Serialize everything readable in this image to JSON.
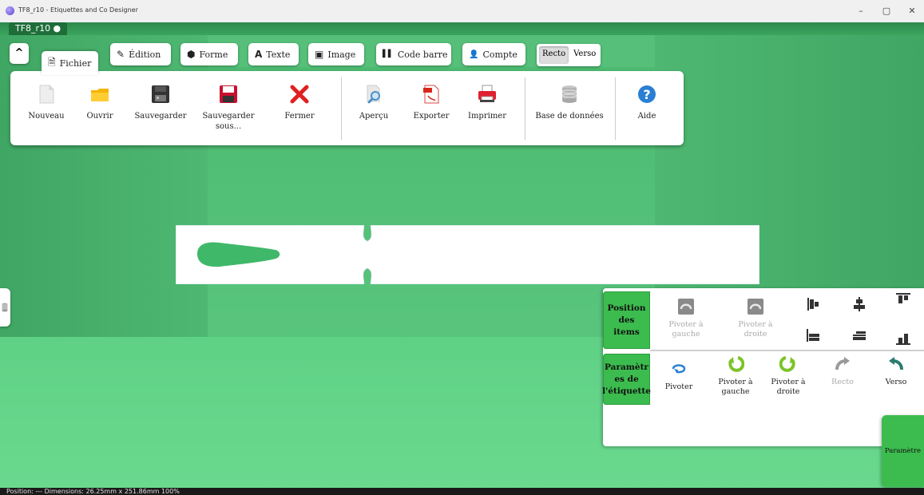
{
  "window": {
    "title": "TF8_r10 - Etiquettes and Co Designer",
    "minimize": "–",
    "maximize": "▢",
    "close": "✕"
  },
  "doc_tab": {
    "label": "TF8_r10 ●"
  },
  "ribbon": {
    "collapse": "^",
    "tabs": [
      {
        "label": "Fichier",
        "icon": "file-icon",
        "glyph": "🗎"
      },
      {
        "label": "Édition",
        "icon": "pencil-icon",
        "glyph": "✎"
      },
      {
        "label": "Forme",
        "icon": "shapes-icon",
        "glyph": "⬢"
      },
      {
        "label": "Texte",
        "icon": "text-icon",
        "glyph": "A"
      },
      {
        "label": "Image",
        "icon": "image-icon",
        "glyph": "▣"
      },
      {
        "label": "Code barre",
        "icon": "barcode-icon",
        "glyph": "▌▌"
      },
      {
        "label": "Compte",
        "icon": "user-icon",
        "glyph": "👤"
      }
    ],
    "recto": "Recto",
    "verso": "Verso",
    "fichier_items": {
      "nouveau": "Nouveau",
      "ouvrir": "Ouvrir",
      "sauvegarder": "Sauvegarder",
      "sauvegarder_sous_1": "Sauvegarder",
      "sauvegarder_sous_2": "sous...",
      "fermer": "Fermer",
      "apercu": "Aperçu",
      "exporter": "Exporter",
      "imprimer": "Imprimer",
      "base": "Base de données",
      "aide": "Aide"
    }
  },
  "position_panel": {
    "section_positions_1": "Position",
    "section_positions_2": "des",
    "section_positions_3": "items",
    "pivoter_gauche_1": "Pivoter à",
    "pivoter_gauche_2": "gauche",
    "pivoter_droite_1": "Pivoter à",
    "pivoter_droite_2": "droite",
    "section_params_1": "Paramètr",
    "section_params_2": "es de",
    "section_params_3": "l'étiquette",
    "pivoter": "Pivoter",
    "pg_1": "Pivoter à",
    "pg_2": "gauche",
    "pd_1": "Pivoter à",
    "pd_2": "droite",
    "recto": "Recto",
    "verso": "Verso"
  },
  "parametres_button": "Paramètre",
  "status_bar": "Position: --- Dimensions: 26.25mm x 251.86mm 100%",
  "colors": {
    "accent_green": "#3cbc4f",
    "background_green": "#4fbf73",
    "close_red": "#e02020"
  }
}
